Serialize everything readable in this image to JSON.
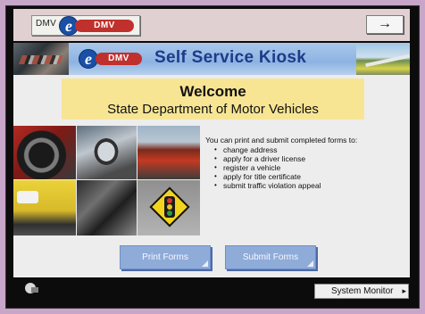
{
  "topbar": {
    "badge_small_text": "DMV",
    "logo_e": "e",
    "logo_pill": "DMV",
    "next_arrow": "→"
  },
  "banner": {
    "logo_e": "e",
    "logo_pill": "DMV",
    "title": "Self Service Kiosk"
  },
  "welcome": {
    "heading": "Welcome",
    "subheading": "State Department of Motor Vehicles"
  },
  "description": {
    "intro": "You can print and submit completed forms to:",
    "items": [
      "change address",
      "apply for a driver license",
      "register a vehicle",
      "apply for title certificate",
      "submit traffic violation appeal"
    ]
  },
  "buttons": {
    "print_forms": "Print Forms",
    "submit_forms": "Submit Forms"
  },
  "footer": {
    "system_monitor": "System Monitor",
    "chevron": "▸"
  },
  "colors": {
    "frame": "#c7a6c9",
    "banner_blue": "#8db3e2",
    "title_blue": "#1d3b8a",
    "welcome_yellow": "#f7e594",
    "button_blue": "#8fabd8",
    "logo_red": "#c0302c"
  }
}
